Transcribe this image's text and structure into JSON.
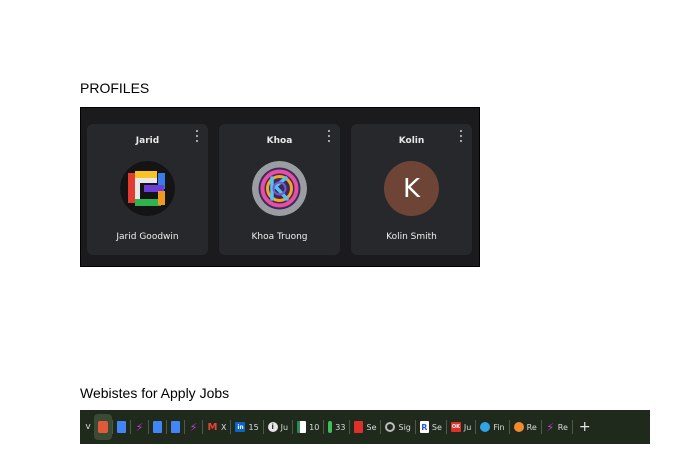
{
  "headings": {
    "profiles": "PROFILES",
    "websites": "Webistes for Apply Jobs"
  },
  "profiles": [
    {
      "name": "Jarid",
      "full_name": "Jarid Goodwin",
      "avatar": "colorful-logo-avatar"
    },
    {
      "name": "Khoa",
      "full_name": "Khoa Truong",
      "avatar": "colorful-logo-avatar"
    },
    {
      "name": "Kolin",
      "full_name": "Kolin Smith",
      "avatar_letter": "K",
      "avatar_color": "#6e4436"
    }
  ],
  "tabbar": {
    "chevron": "v",
    "plus": "+",
    "tabs": [
      {
        "icon": "glassdoor-icon",
        "label": "",
        "color": "#e05a3a"
      },
      {
        "icon": "google-docs-icon",
        "label": "",
        "color": "#4285f4"
      },
      {
        "icon": "lightning-icon",
        "label": "",
        "color": "#c23bd4"
      },
      {
        "icon": "google-docs-icon",
        "label": "",
        "color": "#4285f4"
      },
      {
        "icon": "google-docs-icon",
        "label": "",
        "color": "#4285f4"
      },
      {
        "icon": "lightning-icon",
        "label": "",
        "color": "#c23bd4"
      },
      {
        "icon": "gmail-icon",
        "label": "X",
        "glyph": "M",
        "color": "#ea4335"
      },
      {
        "icon": "linkedin-icon",
        "label": "15",
        "glyph": "in",
        "color": "#0a66c2"
      },
      {
        "icon": "info-icon",
        "label": "Ju",
        "glyph": "i",
        "color": "#e6e6e6"
      },
      {
        "icon": "doc-green-icon",
        "label": "10",
        "color": "#2e8b57"
      },
      {
        "icon": "mic-icon",
        "label": "33",
        "color": "#3fbf5a"
      },
      {
        "icon": "red-doc-icon",
        "label": "Se",
        "color": "#e0302a"
      },
      {
        "icon": "globe-icon",
        "label": "Sig",
        "color": "#bbbbbb"
      },
      {
        "icon": "r-icon",
        "label": "Se",
        "glyph": "R",
        "color": "#2b5fd9"
      },
      {
        "icon": "ok-icon",
        "label": "Ju",
        "glyph": "OK",
        "color": "#e0302a"
      },
      {
        "icon": "edge-icon",
        "label": "Fin",
        "color": "#2fa4e7"
      },
      {
        "icon": "firefox-icon",
        "label": "Re",
        "color": "#f28b2e"
      },
      {
        "icon": "lightning-icon",
        "label": "Re",
        "color": "#c23bd4"
      }
    ]
  }
}
